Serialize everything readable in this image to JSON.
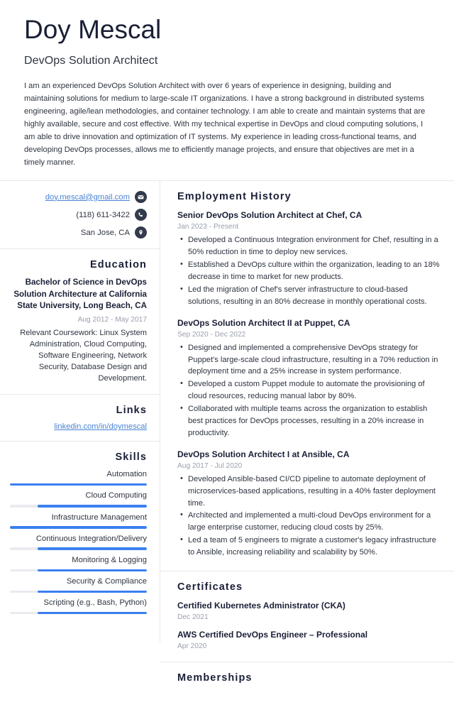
{
  "header": {
    "name": "Doy Mescal",
    "job_title": "DevOps Solution Architect",
    "summary": "I am an experienced DevOps Solution Architect with over 6 years of experience in designing, building and maintaining solutions for medium to large-scale IT organizations. I have a strong background in distributed systems engineering, agile/lean methodologies, and container technology. I am able to create and maintain systems that are highly available, secure and cost effective. With my technical expertise in DevOps and cloud computing solutions, I am able to drive innovation and optimization of IT systems. My experience in leading cross-functional teams, and developing DevOps processes, allows me to efficiently manage projects, and ensure that objectives are met in a timely manner."
  },
  "colors": {
    "accent_blue": "#3b7ff0",
    "link_blue": "#4a83d4",
    "heading_navy": "#1a1f36",
    "muted_gray": "#9aa0ad",
    "divider": "#e6e8ec",
    "icon_circle": "#333b4d"
  },
  "sidebar": {
    "contact": [
      {
        "text": "doy.mescal@gmail.com",
        "icon": "envelope-icon",
        "is_link": true
      },
      {
        "text": "(118) 611-3422",
        "icon": "phone-icon",
        "is_link": false
      },
      {
        "text": "San Jose, CA",
        "icon": "location-pin-icon",
        "is_link": false
      }
    ],
    "education": {
      "heading": "Education",
      "degree": "Bachelor of Science in DevOps Solution Architecture at California State University, Long Beach, CA",
      "date": "Aug 2012 - May 2017",
      "description": "Relevant Coursework: Linux System Administration, Cloud Computing, Software Engineering, Network Security, Database Design and Development."
    },
    "links": {
      "heading": "Links",
      "items": [
        {
          "label": "linkedin.com/in/doymescal"
        }
      ]
    },
    "skills": {
      "heading": "Skills",
      "items": [
        {
          "label": "Automation",
          "level": 100
        },
        {
          "label": "Cloud Computing",
          "level": 80
        },
        {
          "label": "Infrastructure Management",
          "level": 100
        },
        {
          "label": "Continuous Integration/Delivery",
          "level": 80
        },
        {
          "label": "Monitoring & Logging",
          "level": 80
        },
        {
          "label": "Security & Compliance",
          "level": 80
        },
        {
          "label": "Scripting (e.g., Bash, Python)",
          "level": 80
        }
      ]
    }
  },
  "main": {
    "employment": {
      "heading": "Employment History",
      "jobs": [
        {
          "role": "Senior DevOps Solution Architect at Chef, CA",
          "date": "Jan 2023 - Present",
          "points": [
            "Developed a Continuous Integration environment for Chef, resulting in a 50% reduction in time to deploy new services.",
            "Established a DevOps culture within the organization, leading to an 18% decrease in time to market for new products.",
            "Led the migration of Chef's server infrastructure to cloud-based solutions, resulting in an 80% decrease in monthly operational costs."
          ]
        },
        {
          "role": "DevOps Solution Architect II at Puppet, CA",
          "date": "Sep 2020 - Dec 2022",
          "points": [
            "Designed and implemented a comprehensive DevOps strategy for Puppet's large-scale cloud infrastructure, resulting in a 70% reduction in deployment time and a 25% increase in system performance.",
            "Developed a custom Puppet module to automate the provisioning of cloud resources, reducing manual labor by 80%.",
            "Collaborated with multiple teams across the organization to establish best practices for DevOps processes, resulting in a 20% increase in productivity."
          ]
        },
        {
          "role": "DevOps Solution Architect I at Ansible, CA",
          "date": "Aug 2017 - Jul 2020",
          "points": [
            "Developed Ansible-based CI/CD pipeline to automate deployment of microservices-based applications, resulting in a 40% faster deployment time.",
            "Architected and implemented a multi-cloud DevOps environment for a large enterprise customer, reducing cloud costs by 25%.",
            "Led a team of 5 engineers to migrate a customer's legacy infrastructure to Ansible, increasing reliability and scalability by 50%."
          ]
        }
      ]
    },
    "certificates": {
      "heading": "Certificates",
      "items": [
        {
          "name": "Certified Kubernetes Administrator (CKA)",
          "date": "Dec 2021"
        },
        {
          "name": "AWS Certified DevOps Engineer – Professional",
          "date": "Apr 2020"
        }
      ]
    },
    "memberships": {
      "heading": "Memberships"
    }
  }
}
